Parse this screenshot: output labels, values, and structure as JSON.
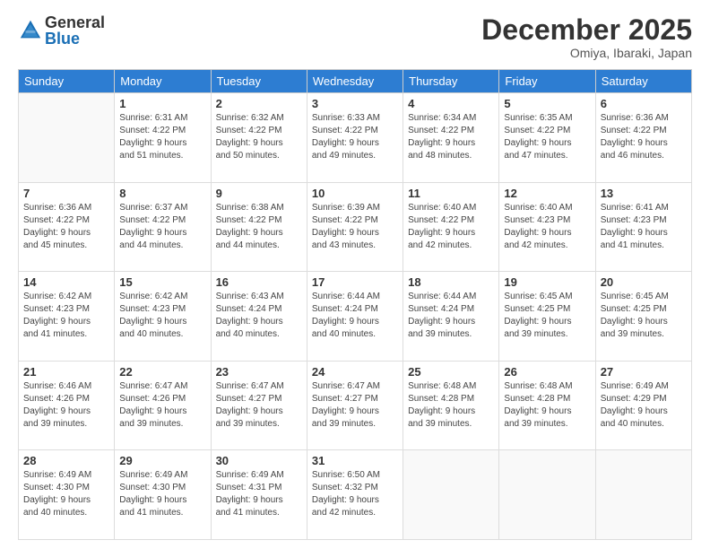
{
  "logo": {
    "general": "General",
    "blue": "Blue"
  },
  "title": "December 2025",
  "location": "Omiya, Ibaraki, Japan",
  "days_of_week": [
    "Sunday",
    "Monday",
    "Tuesday",
    "Wednesday",
    "Thursday",
    "Friday",
    "Saturday"
  ],
  "weeks": [
    [
      {
        "day": "",
        "info": ""
      },
      {
        "day": "1",
        "info": "Sunrise: 6:31 AM\nSunset: 4:22 PM\nDaylight: 9 hours\nand 51 minutes."
      },
      {
        "day": "2",
        "info": "Sunrise: 6:32 AM\nSunset: 4:22 PM\nDaylight: 9 hours\nand 50 minutes."
      },
      {
        "day": "3",
        "info": "Sunrise: 6:33 AM\nSunset: 4:22 PM\nDaylight: 9 hours\nand 49 minutes."
      },
      {
        "day": "4",
        "info": "Sunrise: 6:34 AM\nSunset: 4:22 PM\nDaylight: 9 hours\nand 48 minutes."
      },
      {
        "day": "5",
        "info": "Sunrise: 6:35 AM\nSunset: 4:22 PM\nDaylight: 9 hours\nand 47 minutes."
      },
      {
        "day": "6",
        "info": "Sunrise: 6:36 AM\nSunset: 4:22 PM\nDaylight: 9 hours\nand 46 minutes."
      }
    ],
    [
      {
        "day": "7",
        "info": "Sunrise: 6:36 AM\nSunset: 4:22 PM\nDaylight: 9 hours\nand 45 minutes."
      },
      {
        "day": "8",
        "info": "Sunrise: 6:37 AM\nSunset: 4:22 PM\nDaylight: 9 hours\nand 44 minutes."
      },
      {
        "day": "9",
        "info": "Sunrise: 6:38 AM\nSunset: 4:22 PM\nDaylight: 9 hours\nand 44 minutes."
      },
      {
        "day": "10",
        "info": "Sunrise: 6:39 AM\nSunset: 4:22 PM\nDaylight: 9 hours\nand 43 minutes."
      },
      {
        "day": "11",
        "info": "Sunrise: 6:40 AM\nSunset: 4:22 PM\nDaylight: 9 hours\nand 42 minutes."
      },
      {
        "day": "12",
        "info": "Sunrise: 6:40 AM\nSunset: 4:23 PM\nDaylight: 9 hours\nand 42 minutes."
      },
      {
        "day": "13",
        "info": "Sunrise: 6:41 AM\nSunset: 4:23 PM\nDaylight: 9 hours\nand 41 minutes."
      }
    ],
    [
      {
        "day": "14",
        "info": "Sunrise: 6:42 AM\nSunset: 4:23 PM\nDaylight: 9 hours\nand 41 minutes."
      },
      {
        "day": "15",
        "info": "Sunrise: 6:42 AM\nSunset: 4:23 PM\nDaylight: 9 hours\nand 40 minutes."
      },
      {
        "day": "16",
        "info": "Sunrise: 6:43 AM\nSunset: 4:24 PM\nDaylight: 9 hours\nand 40 minutes."
      },
      {
        "day": "17",
        "info": "Sunrise: 6:44 AM\nSunset: 4:24 PM\nDaylight: 9 hours\nand 40 minutes."
      },
      {
        "day": "18",
        "info": "Sunrise: 6:44 AM\nSunset: 4:24 PM\nDaylight: 9 hours\nand 39 minutes."
      },
      {
        "day": "19",
        "info": "Sunrise: 6:45 AM\nSunset: 4:25 PM\nDaylight: 9 hours\nand 39 minutes."
      },
      {
        "day": "20",
        "info": "Sunrise: 6:45 AM\nSunset: 4:25 PM\nDaylight: 9 hours\nand 39 minutes."
      }
    ],
    [
      {
        "day": "21",
        "info": "Sunrise: 6:46 AM\nSunset: 4:26 PM\nDaylight: 9 hours\nand 39 minutes."
      },
      {
        "day": "22",
        "info": "Sunrise: 6:47 AM\nSunset: 4:26 PM\nDaylight: 9 hours\nand 39 minutes."
      },
      {
        "day": "23",
        "info": "Sunrise: 6:47 AM\nSunset: 4:27 PM\nDaylight: 9 hours\nand 39 minutes."
      },
      {
        "day": "24",
        "info": "Sunrise: 6:47 AM\nSunset: 4:27 PM\nDaylight: 9 hours\nand 39 minutes."
      },
      {
        "day": "25",
        "info": "Sunrise: 6:48 AM\nSunset: 4:28 PM\nDaylight: 9 hours\nand 39 minutes."
      },
      {
        "day": "26",
        "info": "Sunrise: 6:48 AM\nSunset: 4:28 PM\nDaylight: 9 hours\nand 39 minutes."
      },
      {
        "day": "27",
        "info": "Sunrise: 6:49 AM\nSunset: 4:29 PM\nDaylight: 9 hours\nand 40 minutes."
      }
    ],
    [
      {
        "day": "28",
        "info": "Sunrise: 6:49 AM\nSunset: 4:30 PM\nDaylight: 9 hours\nand 40 minutes."
      },
      {
        "day": "29",
        "info": "Sunrise: 6:49 AM\nSunset: 4:30 PM\nDaylight: 9 hours\nand 41 minutes."
      },
      {
        "day": "30",
        "info": "Sunrise: 6:49 AM\nSunset: 4:31 PM\nDaylight: 9 hours\nand 41 minutes."
      },
      {
        "day": "31",
        "info": "Sunrise: 6:50 AM\nSunset: 4:32 PM\nDaylight: 9 hours\nand 42 minutes."
      },
      {
        "day": "",
        "info": ""
      },
      {
        "day": "",
        "info": ""
      },
      {
        "day": "",
        "info": ""
      }
    ]
  ]
}
